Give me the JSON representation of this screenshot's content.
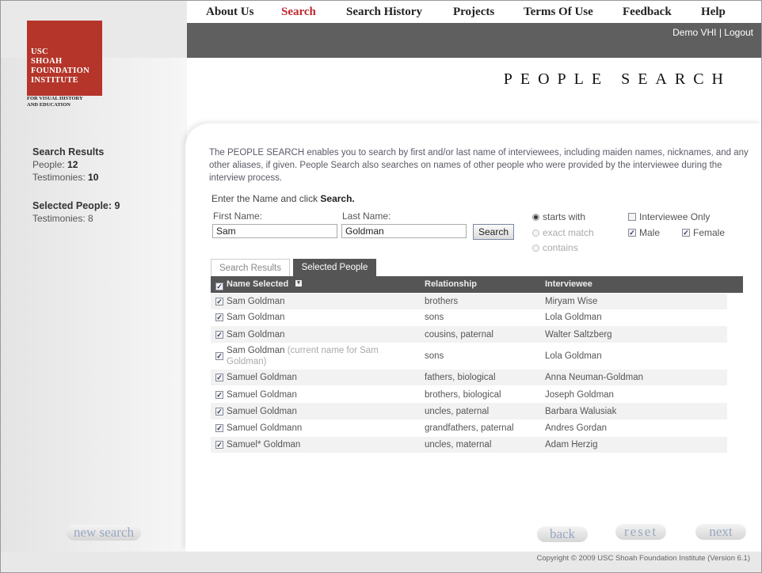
{
  "nav": {
    "items": [
      "About Us",
      "Search",
      "Search History",
      "Projects",
      "Terms Of Use",
      "Feedback",
      "Help"
    ],
    "active": "Search"
  },
  "logo": {
    "lines": [
      "USC",
      "SHOAH",
      "FOUNDATION",
      "INSTITUTE"
    ],
    "subtitle_lines": [
      "FOR VISUAL HISTORY",
      "AND EDUCATION"
    ]
  },
  "user": {
    "account": "Demo VHI",
    "separator": "|",
    "logout": "Logout"
  },
  "page_title": "PEOPLE SEARCH",
  "sidebar": {
    "results_heading": "Search Results",
    "people_label": "People:",
    "people_count": "12",
    "testimonies_label": "Testimonies:",
    "testimonies_count": "10",
    "selected_heading": "Selected People: 9",
    "selected_testimonies_label": "Testimonies:",
    "selected_testimonies_count": "8",
    "new_search": "new search"
  },
  "intro_text": "The PEOPLE SEARCH enables you to search by first and/or last name of interviewees, including maiden names, nicknames, and any other aliases, if given. People Search also searches on names of other people who were provided by the interviewee during the interview process.",
  "prompt": {
    "text": "Enter the Name and click",
    "action": "Search."
  },
  "form": {
    "first_name_label": "First Name:",
    "first_name_value": "Sam",
    "last_name_label": "Last Name:",
    "last_name_value": "Goldman",
    "search_button": "Search",
    "match_options": [
      "starts with",
      "exact match",
      "contains"
    ],
    "match_selected": "starts with",
    "interviewee_only_label": "Interviewee Only",
    "male_label": "Male",
    "female_label": "Female"
  },
  "tabs": [
    "Search Results",
    "Selected People"
  ],
  "active_tab": "Selected People",
  "table": {
    "headers": [
      "Name Selected",
      "Relationship",
      "Interviewee"
    ],
    "rows": [
      {
        "name": "Sam Goldman",
        "note": "",
        "relationship": "brothers",
        "interviewee": "Miryam Wise"
      },
      {
        "name": "Sam Goldman",
        "note": "",
        "relationship": "sons",
        "interviewee": "Lola Goldman"
      },
      {
        "name": "Sam Goldman",
        "note": "",
        "relationship": "cousins, paternal",
        "interviewee": "Walter Saltzberg"
      },
      {
        "name": "Sam Goldman",
        "note": "(current name for Sam Goldman)",
        "relationship": "sons",
        "interviewee": "Lola Goldman"
      },
      {
        "name": "Samuel Goldman",
        "note": "",
        "relationship": "fathers, biological",
        "interviewee": "Anna Neuman-Goldman"
      },
      {
        "name": "Samuel Goldman",
        "note": "",
        "relationship": "brothers, biological",
        "interviewee": "Joseph Goldman"
      },
      {
        "name": "Samuel Goldman",
        "note": "",
        "relationship": "uncles, paternal",
        "interviewee": "Barbara Walusiak"
      },
      {
        "name": "Samuel Goldmann",
        "note": "",
        "relationship": "grandfathers, paternal",
        "interviewee": "Andres Gordan"
      },
      {
        "name": "Samuel* Goldman",
        "note": "",
        "relationship": "uncles, maternal",
        "interviewee": "Adam Herzig"
      }
    ]
  },
  "buttons": {
    "back": "back",
    "reset": "reset",
    "next": "next"
  },
  "copyright": "Copyright © 2009 USC Shoah Foundation Institute (Version 6.1)"
}
